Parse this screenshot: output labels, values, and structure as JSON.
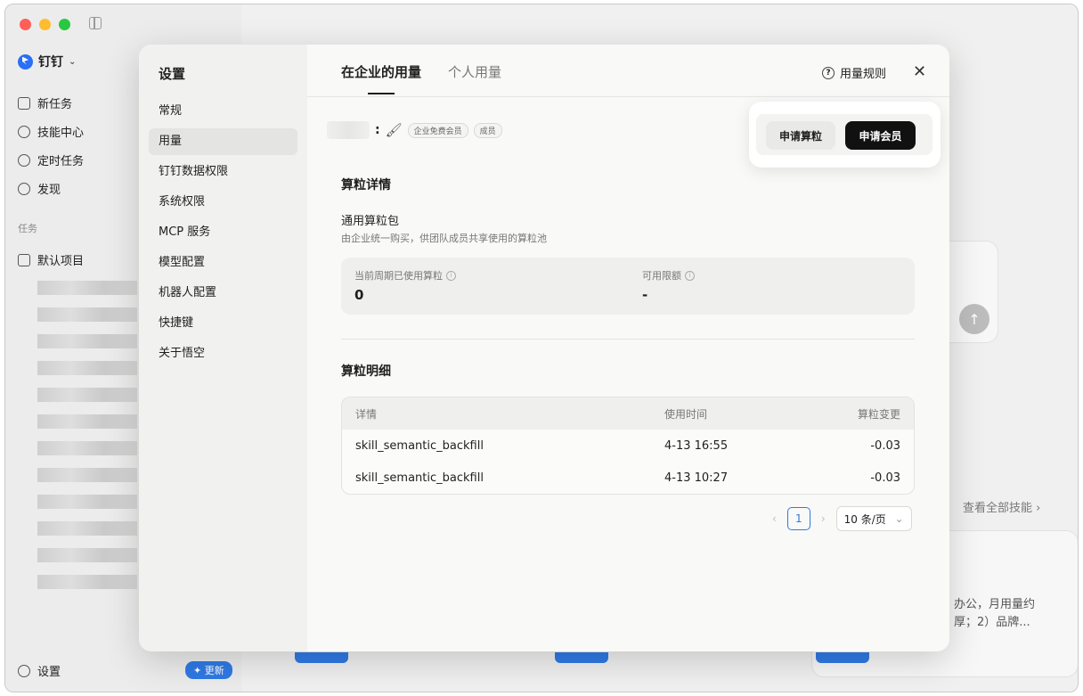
{
  "app": {
    "name": "钉钉",
    "nav": [
      {
        "label": "新任务",
        "icon": "edit-icon"
      },
      {
        "label": "技能中心",
        "icon": "skills-icon"
      },
      {
        "label": "定时任务",
        "icon": "clock-icon"
      },
      {
        "label": "发现",
        "icon": "discover-icon"
      }
    ],
    "section_label": "任务",
    "default_project": "默认项目",
    "settings_label": "设置",
    "update_label": "更新"
  },
  "background": {
    "view_all_skills": "查看全部技能 ›",
    "snippet_line1": "办公，月用量约",
    "snippet_line2": "厚；2）品牌..."
  },
  "settings": {
    "title": "设置",
    "menu": [
      {
        "label": "常规",
        "active": false
      },
      {
        "label": "用量",
        "active": true
      },
      {
        "label": "钉钉数据权限",
        "active": false
      },
      {
        "label": "系统权限",
        "active": false
      },
      {
        "label": "MCP 服务",
        "active": false
      },
      {
        "label": "模型配置",
        "active": false
      },
      {
        "label": "机器人配置",
        "active": false
      },
      {
        "label": "快捷键",
        "active": false
      },
      {
        "label": "关于悟空",
        "active": false
      }
    ],
    "tabs": [
      "在企业的用量",
      "个人用量"
    ],
    "rules_label": "用量规则",
    "close_icon": "close-icon",
    "user": {
      "separator": ":",
      "tags": [
        "企业免费会员",
        "成员"
      ]
    },
    "buttons": {
      "apply_compute": "申请算粒",
      "apply_member": "申请会员"
    },
    "details": {
      "heading": "算粒详情",
      "package_title": "通用算粒包",
      "package_desc": "由企业统一购买，供团队成员共享使用的算粒池",
      "used_label": "当前周期已使用算粒",
      "used_value": "0",
      "limit_label": "可用限额",
      "limit_value": "-"
    },
    "ledger": {
      "heading": "算粒明细",
      "columns": [
        "详情",
        "使用时间",
        "算粒变更"
      ],
      "rows": [
        [
          "skill_semantic_backfill",
          "4-13 16:55",
          "-0.03"
        ],
        [
          "skill_semantic_backfill",
          "4-13 10:27",
          "-0.03"
        ]
      ]
    },
    "pagination": {
      "current": "1",
      "page_size": "10 条/页"
    }
  }
}
